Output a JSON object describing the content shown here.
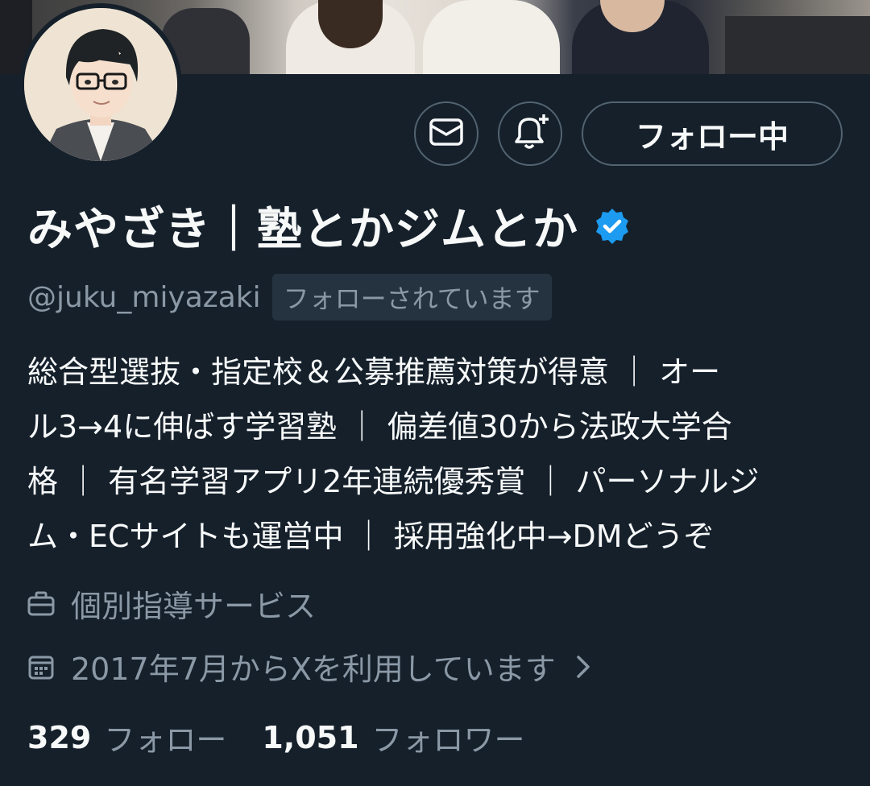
{
  "profile": {
    "display_name": "みやざき｜塾とかジムとか",
    "handle": "@juku_miyazaki",
    "follows_you": "フォローされています",
    "verified": true,
    "accent_color": "#1d9bf0"
  },
  "actions": {
    "follow_label": "フォロー中",
    "message_icon": "envelope-icon",
    "notify_icon": "bell-plus-icon"
  },
  "bio": {
    "lines": [
      "総合型選抜・指定校＆公募推薦対策が得意 ｜ オー",
      "ル3→4に伸ばす学習塾 ｜ 偏差値30から法政大学合",
      "格 ｜ 有名学習アプリ2年連続優秀賞 ｜ パーソナルジ",
      "ム・ECサイトも運営中 ｜ 採用強化中→DMどうぞ"
    ]
  },
  "meta": {
    "category": "個別指導サービス",
    "joined": "2017年7月からXを利用しています"
  },
  "stats": {
    "following_count": "329",
    "following_label": "フォロー",
    "followers_count": "1,051",
    "followers_label": "フォロワー"
  }
}
